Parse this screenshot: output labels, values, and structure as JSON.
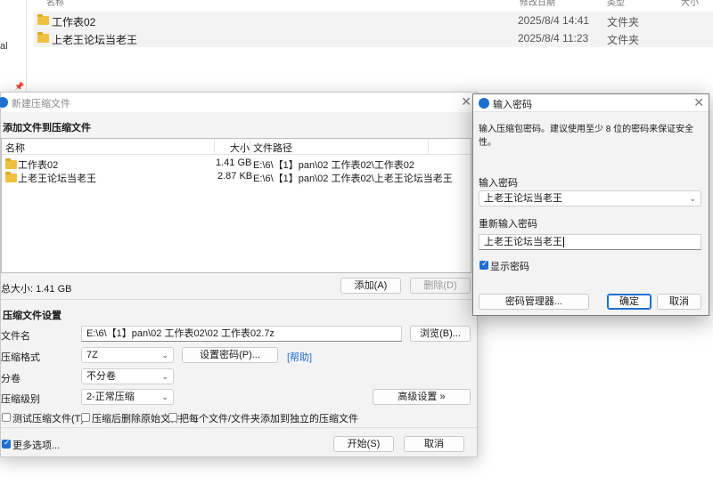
{
  "explorer": {
    "nav_text": "al",
    "header": {
      "name": "名称",
      "date": "修改日期",
      "type": "类型",
      "size": "大小"
    },
    "rows": [
      {
        "name": "工作表02",
        "date": "2025/8/4 14:41",
        "type": "文件夹"
      },
      {
        "name": "上老王论坛当老王",
        "date": "2025/8/4 11:23",
        "type": "文件夹"
      }
    ]
  },
  "main_dialog": {
    "title": "新建压缩文件",
    "add_section": "添加文件到压缩文件",
    "columns": {
      "name": "名称",
      "size": "大小",
      "path": "文件路径"
    },
    "files": [
      {
        "name": "工作表02",
        "size": "1.41 GB",
        "path": "E:\\6\\【1】pan\\02 工作表02\\工作表02"
      },
      {
        "name": "上老王论坛当老王",
        "size": "2.87 KB",
        "path": "E:\\6\\【1】pan\\02 工作表02\\上老王论坛当老王"
      }
    ],
    "total": "总大小: 1.41 GB",
    "add_button": "添加(A)",
    "delete_button": "删除(D)",
    "settings_section": "压缩文件设置",
    "filename_label": "文件名",
    "filename_value": "E:\\6\\【1】pan\\02 工作表02\\02 工作表02.7z",
    "browse_button": "浏览(B)...",
    "format_label": "压缩格式",
    "format_value": "7Z",
    "set_password_button": "设置密码(P)...",
    "help_link": "[帮助]",
    "split_label": "分卷",
    "split_value": "不分卷",
    "level_label": "压缩级别",
    "level_value": "2-正常压缩",
    "advanced_button": "高级设置 »",
    "test_checkbox": "测试压缩文件(T)",
    "delete_source_checkbox": "压缩后删除原始文件",
    "separate_checkbox": "把每个文件/文件夹添加到独立的压缩文件",
    "more_options": "更多选项...",
    "start_button": "开始(S)",
    "cancel_button": "取消"
  },
  "password_dialog": {
    "title": "输入密码",
    "description": "输入压缩包密码。建议使用至少 8 位的密码来保证安全性。",
    "enter_label": "输入密码",
    "enter_value": "上老王论坛当老王",
    "reenter_label": "重新输入密码",
    "reenter_value": "上老王论坛当老王",
    "show_password": "显示密码",
    "manager_button": "密码管理器...",
    "ok_button": "确定",
    "cancel_button": "取消"
  },
  "colors": {
    "accent": "#1f6fd0",
    "folder": "#f0c040",
    "dialog_bg": "#f3f3f3"
  }
}
